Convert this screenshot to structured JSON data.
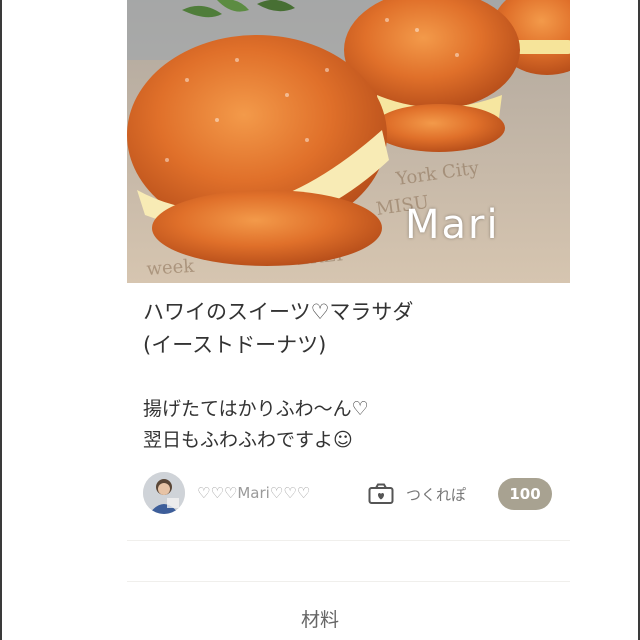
{
  "recipe": {
    "title_line1": "ハワイのスイーツ♡マラサダ",
    "title_line2": "(イーストドーナツ)",
    "description_line1": "揚げたてはかりふわ〜ん♡",
    "description_line2": "翌日もふわふわですよ☺",
    "photo_watermark": "Mari"
  },
  "author": {
    "name": "♡♡♡Mari♡♡♡"
  },
  "tsukurepo": {
    "label": "つくれぽ",
    "count": "100",
    "icon": "camera-icon"
  },
  "section": {
    "title": "材料"
  },
  "colors": {
    "badge_bg": "#a8a291",
    "text": "#333333",
    "muted_text": "#9a9a9a"
  }
}
